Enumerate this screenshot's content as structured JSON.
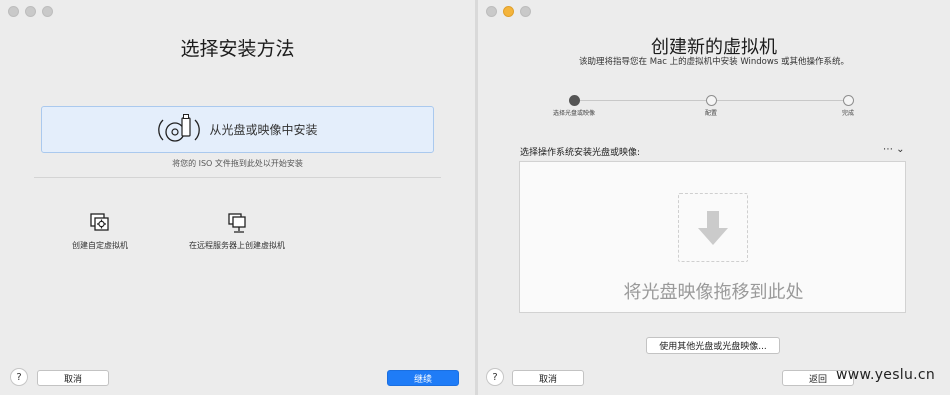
{
  "left": {
    "title": "选择安装方法",
    "install_button": {
      "label": "从光盘或映像中安装",
      "icon": "disc-usb-icon"
    },
    "hint": "将您的 ISO 文件拖到此处以开始安装",
    "options": [
      {
        "label": "创建自定虚拟机",
        "icon": "custom-vm-icon"
      },
      {
        "label": "在远程服务器上创建虚拟机",
        "icon": "remote-server-icon"
      }
    ],
    "help": "?",
    "cancel": "取消",
    "continue": "继续"
  },
  "right": {
    "title": "创建新的虚拟机",
    "subtitle": "该助理将指导您在 Mac 上的虚拟机中安装 Windows 或其他操作系统。",
    "steps": [
      "选择光盘或映像",
      "配置",
      "完成"
    ],
    "select_label": "选择操作系统安装光盘或映像:",
    "more": "⋯ ⌄",
    "drop_text": "将光盘映像拖移到此处",
    "other_button": "使用其他光盘或光盘映像...",
    "help": "?",
    "cancel": "取消",
    "back": "返回"
  },
  "watermark": "www.yeslu.cn",
  "colors": {
    "accent": "#1f7cf7",
    "selection_bg": "#e4eefb",
    "window_bg": "#ececec"
  }
}
